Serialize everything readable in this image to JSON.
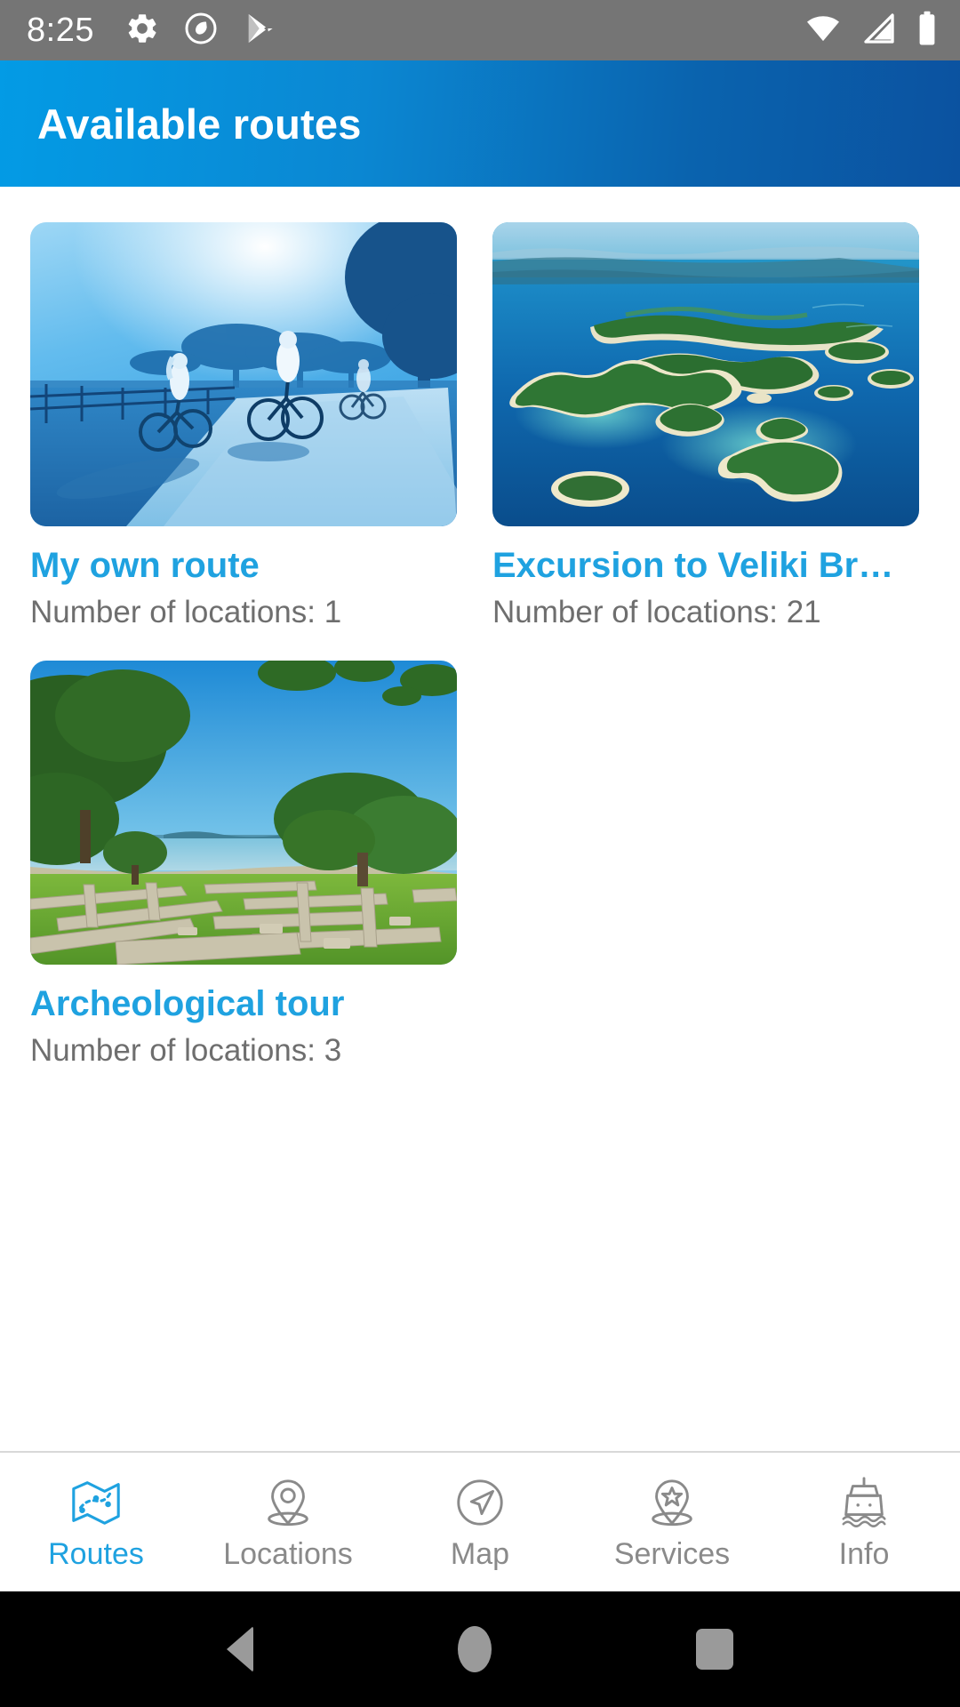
{
  "status_bar": {
    "time": "8:25",
    "left_icons": [
      "gear-icon",
      "android-q-circle-icon",
      "play-store-icon"
    ],
    "right_icons": [
      "wifi-icon",
      "cellular-signal-icon",
      "battery-icon"
    ],
    "background_color": "#757575",
    "foreground_color": "#FFFFFF"
  },
  "app_bar": {
    "title": "Available routes",
    "gradient_start": "#039BE5",
    "gradient_end": "#0B52A0",
    "text_color": "#FFFFFF"
  },
  "theme": {
    "accent": "#1FA2E0",
    "muted_text": "#6E6E6E",
    "nav_inactive": "#8A8A8A",
    "divider": "#D8D8D8",
    "page_background": "#FFFFFF"
  },
  "routes": [
    {
      "title": "My own route",
      "subtitle": "Number of locations: 1",
      "locations_count": 1,
      "image": "blue-tinted-cyclists-on-country-road"
    },
    {
      "title": "Excursion to Veliki Br…",
      "subtitle": "Number of locations: 21",
      "locations_count": 21,
      "image": "aerial-view-brijuni-islands-archipelago"
    },
    {
      "title": "Archeological tour",
      "subtitle": "Number of locations: 3",
      "locations_count": 3,
      "image": "roman-ruins-by-the-sea"
    }
  ],
  "bottom_nav": {
    "active_index": 0,
    "items": [
      {
        "label": "Routes",
        "icon": "folded-map-route-icon"
      },
      {
        "label": "Locations",
        "icon": "map-pin-icon"
      },
      {
        "label": "Map",
        "icon": "navigation-arrow-circle-icon"
      },
      {
        "label": "Services",
        "icon": "map-pin-star-icon"
      },
      {
        "label": "Info",
        "icon": "ship-boat-icon"
      }
    ]
  },
  "android_nav": {
    "buttons": [
      "back-triangle-button",
      "home-circle-button",
      "recents-square-button"
    ],
    "background_color": "#000000"
  }
}
